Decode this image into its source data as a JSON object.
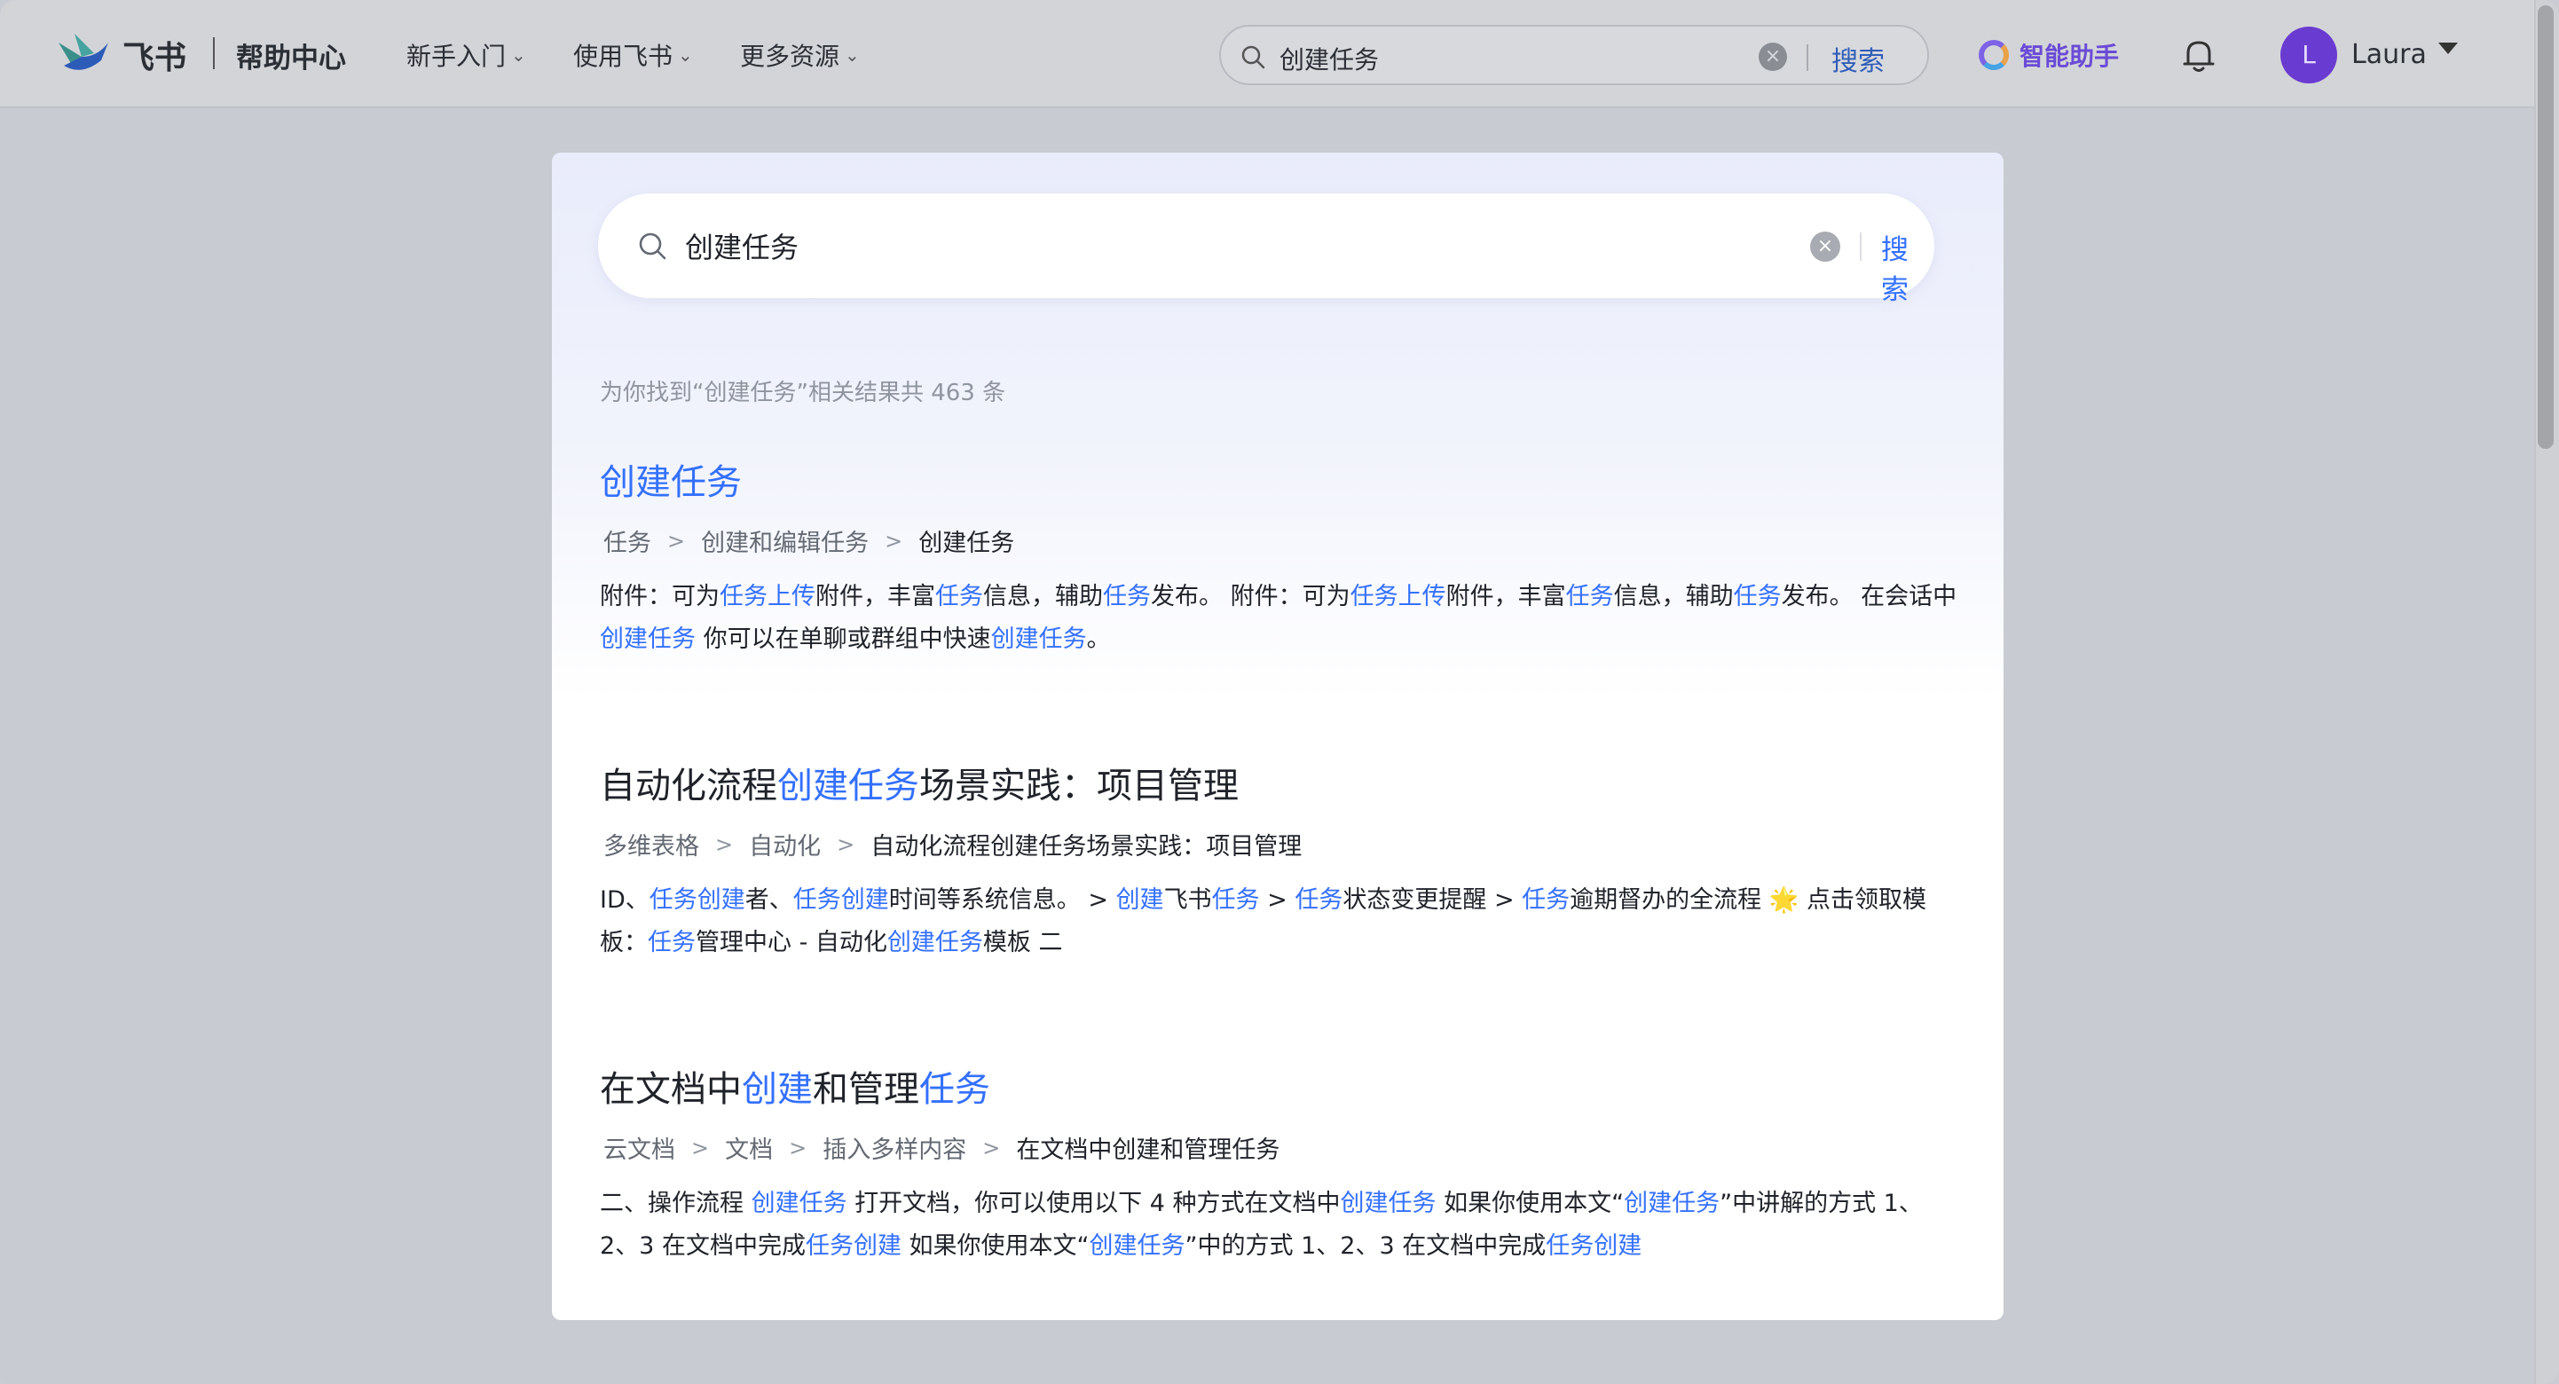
{
  "brand": {
    "name": "飞书",
    "section": "帮助中心"
  },
  "nav": [
    {
      "label": "新手入门"
    },
    {
      "label": "使用飞书"
    },
    {
      "label": "更多资源"
    }
  ],
  "top_search": {
    "value": "创建任务",
    "button": "搜索"
  },
  "assistant": {
    "label": "智能助手"
  },
  "user": {
    "initial": "L",
    "name": "Laura"
  },
  "modal": {
    "search_value": "创建任务",
    "search_button": "搜索",
    "result_count": "为你找到“创建任务”相关结果共 463 条",
    "results": [
      {
        "title_parts": [
          {
            "text": "创建任务",
            "hl": true
          }
        ],
        "breadcrumbs": [
          "任务",
          "创建和编辑任务",
          "创建任务"
        ],
        "snippet_parts": [
          {
            "text": "附件：可为",
            "hl": false
          },
          {
            "text": "任务上传",
            "hl": true
          },
          {
            "text": "附件，丰富",
            "hl": false
          },
          {
            "text": "任务",
            "hl": true
          },
          {
            "text": "信息，辅助",
            "hl": false
          },
          {
            "text": "任务",
            "hl": true
          },
          {
            "text": "发布。 附件：可为",
            "hl": false
          },
          {
            "text": "任务上传",
            "hl": true
          },
          {
            "text": "附件，丰富",
            "hl": false
          },
          {
            "text": "任务",
            "hl": true
          },
          {
            "text": "信息，辅助",
            "hl": false
          },
          {
            "text": "任务",
            "hl": true
          },
          {
            "text": "发布。 在会话中",
            "hl": false
          },
          {
            "text": "创建任务",
            "hl": true
          },
          {
            "text": " 你可以在单聊或群组中快速",
            "hl": false
          },
          {
            "text": "创建任务",
            "hl": true
          },
          {
            "text": "。",
            "hl": false
          }
        ]
      },
      {
        "title_parts": [
          {
            "text": "自动化流程",
            "hl": false
          },
          {
            "text": "创建任务",
            "hl": true
          },
          {
            "text": "场景实践：项目管理",
            "hl": false
          }
        ],
        "breadcrumbs": [
          "多维表格",
          "自动化",
          "自动化流程创建任务场景实践：项目管理"
        ],
        "snippet_parts": [
          {
            "text": "ID、",
            "hl": false
          },
          {
            "text": "任务创建",
            "hl": true
          },
          {
            "text": "者、",
            "hl": false
          },
          {
            "text": "任务创建",
            "hl": true
          },
          {
            "text": "时间等系统信息。 > ",
            "hl": false
          },
          {
            "text": "创建",
            "hl": true
          },
          {
            "text": "飞书",
            "hl": false
          },
          {
            "text": "任务",
            "hl": true
          },
          {
            "text": " > ",
            "hl": false
          },
          {
            "text": "任务",
            "hl": true
          },
          {
            "text": "状态变更提醒 > ",
            "hl": false
          },
          {
            "text": "任务",
            "hl": true
          },
          {
            "text": "逾期督办的全流程 🌟 点击领取模板：",
            "hl": false
          },
          {
            "text": "任务",
            "hl": true
          },
          {
            "text": "管理中心 - 自动化",
            "hl": false
          },
          {
            "text": "创建任务",
            "hl": true
          },
          {
            "text": "模板 二",
            "hl": false
          }
        ]
      },
      {
        "title_parts": [
          {
            "text": "在文档中",
            "hl": false
          },
          {
            "text": "创建",
            "hl": true
          },
          {
            "text": "和管理",
            "hl": false
          },
          {
            "text": "任务",
            "hl": true
          }
        ],
        "breadcrumbs": [
          "云文档",
          "文档",
          "插入多样内容",
          "在文档中创建和管理任务"
        ],
        "snippet_parts": [
          {
            "text": "二、操作流程 ",
            "hl": false
          },
          {
            "text": "创建任务",
            "hl": true
          },
          {
            "text": " 打开文档，你可以使用以下 4 种方式在文档中",
            "hl": false
          },
          {
            "text": "创建任务",
            "hl": true
          },
          {
            "text": " 如果你使用本文“",
            "hl": false
          },
          {
            "text": "创建任务",
            "hl": true
          },
          {
            "text": "”中讲解的方式 1、2、3 在文档中完成",
            "hl": false
          },
          {
            "text": "任务创建",
            "hl": true
          },
          {
            "text": " 如果你使用本文“",
            "hl": false
          },
          {
            "text": "创建任务",
            "hl": true
          },
          {
            "text": "”中的方式 1、2、3 在文档中完成",
            "hl": false
          },
          {
            "text": "任务创建",
            "hl": true
          }
        ]
      }
    ]
  },
  "colors": {
    "accent": "#3370ff",
    "overlay": "#c8cbd1",
    "avatar": "#6a3bd0"
  }
}
